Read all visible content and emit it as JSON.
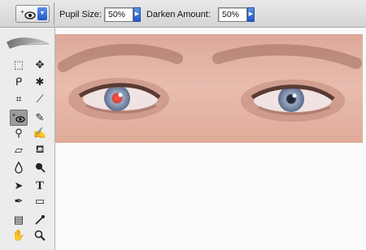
{
  "options_bar": {
    "tool_preset_icon": "red-eye-tool-icon",
    "pupil_size": {
      "label": "Pupil Size:",
      "value": "50%"
    },
    "darken_amount": {
      "label": "Darken Amount:",
      "value": "50%"
    }
  },
  "tools": [
    {
      "name": "marquee-icon",
      "glyph": "⬚"
    },
    {
      "name": "move-icon",
      "glyph": "✥"
    },
    {
      "name": "lasso-icon",
      "glyph": "ᑭ"
    },
    {
      "name": "magic-wand-icon",
      "glyph": "✱"
    },
    {
      "name": "crop-icon",
      "glyph": "⌗"
    },
    {
      "name": "slice-icon",
      "glyph": "⟋"
    },
    {
      "name": "red-eye-icon",
      "glyph": "⁺ₒ"
    },
    {
      "name": "brush-icon",
      "glyph": "✎"
    },
    {
      "name": "stamp-icon",
      "glyph": "⚲"
    },
    {
      "name": "history-brush-icon",
      "glyph": "✍"
    },
    {
      "name": "eraser-icon",
      "glyph": "▱"
    },
    {
      "name": "bucket-icon",
      "glyph": "⛾"
    },
    {
      "name": "blur-icon",
      "glyph": "💧"
    },
    {
      "name": "dodge-icon",
      "glyph": "●"
    },
    {
      "name": "path-select-icon",
      "glyph": "➤"
    },
    {
      "name": "type-icon",
      "glyph": "T"
    },
    {
      "name": "pen-icon",
      "glyph": "✒"
    },
    {
      "name": "rectangle-icon",
      "glyph": "▭"
    },
    {
      "name": "notes-icon",
      "glyph": "▤"
    },
    {
      "name": "eyedropper-icon",
      "glyph": "⚗"
    },
    {
      "name": "hand-icon",
      "glyph": "✋"
    },
    {
      "name": "zoom-icon",
      "glyph": "🔍"
    }
  ],
  "colors": {
    "stepper_blue": "#2563d6",
    "skin": "#e6b7a6",
    "red_pupil": "#e23a3a"
  }
}
